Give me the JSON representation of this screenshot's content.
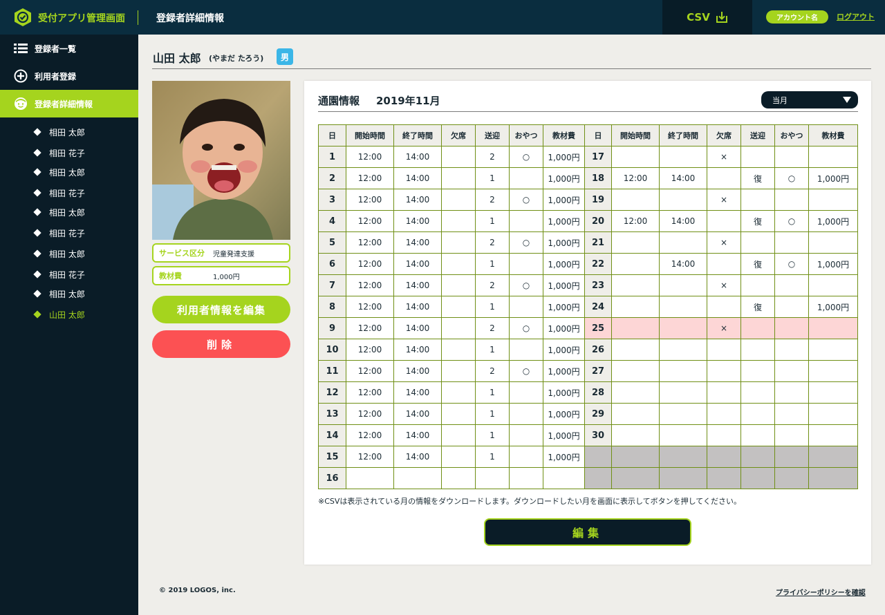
{
  "header": {
    "app_title": "受付アプリ管理画面",
    "page_heading": "登録者詳細情報",
    "csv_label": "CSV",
    "account_label": "アカウント名",
    "logout_label": "ログアウト"
  },
  "sidebar": {
    "nav": [
      {
        "label": "登録者一覧",
        "icon": "list-icon"
      },
      {
        "label": "利用者登録",
        "icon": "plus-circle-icon"
      },
      {
        "label": "登録者詳細情報",
        "icon": "face-icon"
      }
    ],
    "users": [
      "相田 太郎",
      "相田 花子",
      "相田 太郎",
      "相田 花子",
      "相田 太郎",
      "相田 花子",
      "相田 太郎",
      "相田 花子",
      "相田 太郎",
      "山田 太郎"
    ]
  },
  "profile": {
    "name": "山田 太郎",
    "kana": "(やまだ たろう)",
    "gender": "男",
    "service_label": "サービス区分",
    "service_value": "児童発達支援",
    "material_label": "教材費",
    "material_value": "1,000円",
    "edit_button": "利用者情報を編集",
    "delete_button": "削除"
  },
  "card": {
    "title": "通園情報",
    "month": "2019年11月",
    "select_value": "当月",
    "note": "※CSVは表示されている月の情報をダウンロードします。ダウンロードしたい月を画面に表示してボタンを押してください。",
    "edit_button": "編集"
  },
  "table": {
    "headers": [
      "日",
      "開始時間",
      "終了時間",
      "欠席",
      "送迎",
      "おやつ",
      "教材費"
    ],
    "left_rows": [
      {
        "day": "1",
        "start": "12:00",
        "end": "14:00",
        "absent": "",
        "transfer": "2",
        "snack": "○",
        "fee": "1,000円"
      },
      {
        "day": "2",
        "start": "12:00",
        "end": "14:00",
        "absent": "",
        "transfer": "1",
        "snack": "",
        "fee": "1,000円"
      },
      {
        "day": "3",
        "start": "12:00",
        "end": "14:00",
        "absent": "",
        "transfer": "2",
        "snack": "○",
        "fee": "1,000円"
      },
      {
        "day": "4",
        "start": "12:00",
        "end": "14:00",
        "absent": "",
        "transfer": "1",
        "snack": "",
        "fee": "1,000円"
      },
      {
        "day": "5",
        "start": "12:00",
        "end": "14:00",
        "absent": "",
        "transfer": "2",
        "snack": "○",
        "fee": "1,000円"
      },
      {
        "day": "6",
        "start": "12:00",
        "end": "14:00",
        "absent": "",
        "transfer": "1",
        "snack": "",
        "fee": "1,000円"
      },
      {
        "day": "7",
        "start": "12:00",
        "end": "14:00",
        "absent": "",
        "transfer": "2",
        "snack": "○",
        "fee": "1,000円"
      },
      {
        "day": "8",
        "start": "12:00",
        "end": "14:00",
        "absent": "",
        "transfer": "1",
        "snack": "",
        "fee": "1,000円"
      },
      {
        "day": "9",
        "start": "12:00",
        "end": "14:00",
        "absent": "",
        "transfer": "2",
        "snack": "○",
        "fee": "1,000円"
      },
      {
        "day": "10",
        "start": "12:00",
        "end": "14:00",
        "absent": "",
        "transfer": "1",
        "snack": "",
        "fee": "1,000円"
      },
      {
        "day": "11",
        "start": "12:00",
        "end": "14:00",
        "absent": "",
        "transfer": "2",
        "snack": "○",
        "fee": "1,000円"
      },
      {
        "day": "12",
        "start": "12:00",
        "end": "14:00",
        "absent": "",
        "transfer": "1",
        "snack": "",
        "fee": "1,000円"
      },
      {
        "day": "13",
        "start": "12:00",
        "end": "14:00",
        "absent": "",
        "transfer": "1",
        "snack": "",
        "fee": "1,000円"
      },
      {
        "day": "14",
        "start": "12:00",
        "end": "14:00",
        "absent": "",
        "transfer": "1",
        "snack": "",
        "fee": "1,000円"
      },
      {
        "day": "15",
        "start": "12:00",
        "end": "14:00",
        "absent": "",
        "transfer": "1",
        "snack": "",
        "fee": "1,000円"
      },
      {
        "day": "16",
        "start": "",
        "end": "",
        "absent": "",
        "transfer": "",
        "snack": "",
        "fee": ""
      }
    ],
    "right_rows": [
      {
        "day": "17",
        "start": "",
        "end": "",
        "absent": "×",
        "transfer": "",
        "snack": "",
        "fee": ""
      },
      {
        "day": "18",
        "start": "12:00",
        "end": "14:00",
        "absent": "",
        "transfer": "復",
        "snack": "○",
        "fee": "1,000円"
      },
      {
        "day": "19",
        "start": "",
        "end": "",
        "absent": "×",
        "transfer": "",
        "snack": "",
        "fee": ""
      },
      {
        "day": "20",
        "start": "12:00",
        "end": "14:00",
        "absent": "",
        "transfer": "復",
        "snack": "○",
        "fee": "1,000円"
      },
      {
        "day": "21",
        "start": "",
        "end": "",
        "absent": "×",
        "transfer": "",
        "snack": "",
        "fee": ""
      },
      {
        "day": "22",
        "start": "",
        "end": "14:00",
        "absent": "",
        "transfer": "復",
        "snack": "○",
        "fee": "1,000円"
      },
      {
        "day": "23",
        "start": "",
        "end": "",
        "absent": "×",
        "transfer": "",
        "snack": "",
        "fee": ""
      },
      {
        "day": "24",
        "start": "",
        "end": "",
        "absent": "",
        "transfer": "復",
        "snack": "",
        "fee": "1,000円"
      },
      {
        "day": "25",
        "start": "",
        "end": "",
        "absent": "×",
        "transfer": "",
        "snack": "",
        "fee": "",
        "highlight": true
      },
      {
        "day": "26",
        "start": "",
        "end": "",
        "absent": "",
        "transfer": "",
        "snack": "",
        "fee": ""
      },
      {
        "day": "27",
        "start": "",
        "end": "",
        "absent": "",
        "transfer": "",
        "snack": "",
        "fee": ""
      },
      {
        "day": "28",
        "start": "",
        "end": "",
        "absent": "",
        "transfer": "",
        "snack": "",
        "fee": ""
      },
      {
        "day": "29",
        "start": "",
        "end": "",
        "absent": "",
        "transfer": "",
        "snack": "",
        "fee": ""
      },
      {
        "day": "30",
        "start": "",
        "end": "",
        "absent": "",
        "transfer": "",
        "snack": "",
        "fee": ""
      },
      {
        "day": "",
        "start": "",
        "end": "",
        "absent": "",
        "transfer": "",
        "snack": "",
        "fee": "",
        "disabled": true
      },
      {
        "day": "",
        "start": "",
        "end": "",
        "absent": "",
        "transfer": "",
        "snack": "",
        "fee": "",
        "disabled": true
      }
    ]
  },
  "footer": {
    "copyright": "© 2019 LOGOS, inc.",
    "privacy": "プライバシーポリシーを確認"
  },
  "colors": {
    "accent": "#a5d41e",
    "header_bg": "#0a2d3f",
    "sidebar_bg": "#0a1c27",
    "danger": "#fc5153",
    "badge_blue": "#3bb6e7",
    "highlight_row": "#fdd6d6",
    "disabled_cell": "#c3c1c1"
  }
}
